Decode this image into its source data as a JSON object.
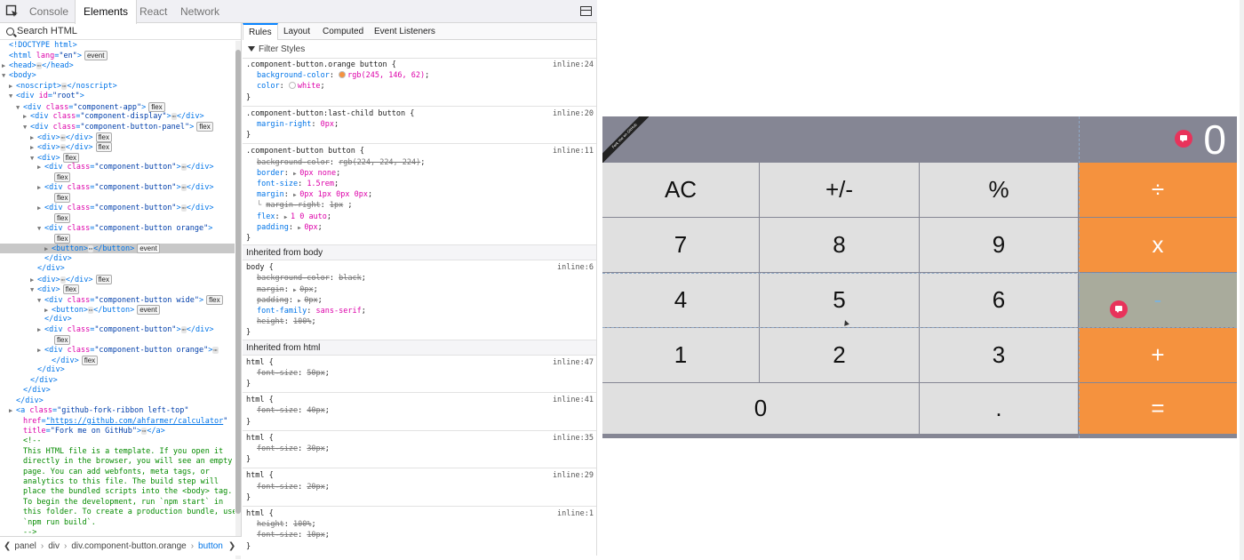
{
  "devtools": {
    "tabs": [
      "Console",
      "Elements",
      "React",
      "Network"
    ],
    "active_tab": "Elements",
    "search_placeholder": "Search HTML",
    "markup_lines": [
      {
        "html": "<span class='tg'>&lt;!DOCTYPE html&gt;</span>",
        "indent": 0,
        "tw": ""
      },
      {
        "html": "<span class='tg'>&lt;html </span><span class='at'>lang</span>=<span class='av'>\"en\"</span><span class='tg'>&gt;</span><span class='badge'>event</span>",
        "indent": 0,
        "tw": ""
      },
      {
        "html": "<span class='tg'>&lt;head&gt;</span><span class='dots'>⋯</span><span class='tg'>&lt;/head&gt;</span>",
        "indent": 0,
        "tw": "▶"
      },
      {
        "html": "<span class='tg'>&lt;body&gt;</span>",
        "indent": 0,
        "tw": "▼"
      },
      {
        "html": "<span class='tg'>&lt;noscript&gt;</span><span class='dots'>⋯</span><span class='tg'>&lt;/noscript&gt;</span>",
        "indent": 1,
        "tw": "▶"
      },
      {
        "html": "<span class='tg'>&lt;div </span><span class='at'>id</span>=<span class='av'>\"root\"</span><span class='tg'>&gt;</span>",
        "indent": 1,
        "tw": "▼"
      },
      {
        "html": "<span class='tg'>&lt;div </span><span class='at'>class</span>=<span class='av'>\"component-app\"</span><span class='tg'>&gt;</span><span class='badge'>flex</span>",
        "indent": 2,
        "tw": "▼"
      },
      {
        "html": "<span class='tg'>&lt;div </span><span class='at'>class</span>=<span class='av'>\"component-display\"</span><span class='tg'>&gt;</span><span class='dots'>⋯</span><span class='tg'>&lt;/div&gt;</span>",
        "indent": 3,
        "tw": "▶"
      },
      {
        "html": "<span class='tg'>&lt;div </span><span class='at'>class</span>=<span class='av'>\"component-button-panel\"</span><span class='tg'>&gt;</span><span class='badge'>flex</span>",
        "indent": 3,
        "tw": "▼"
      },
      {
        "html": "<span class='tg'>&lt;div&gt;</span><span class='dots'>⋯</span><span class='tg'>&lt;/div&gt;</span><span class='badge'>flex</span>",
        "indent": 4,
        "tw": "▶"
      },
      {
        "html": "<span class='tg'>&lt;div&gt;</span><span class='dots'>⋯</span><span class='tg'>&lt;/div&gt;</span><span class='badge'>flex</span>",
        "indent": 4,
        "tw": "▶"
      },
      {
        "html": "<span class='tg'>&lt;div&gt;</span><span class='badge'>flex</span>",
        "indent": 4,
        "tw": "▼"
      },
      {
        "html": "<span class='tg'>&lt;div </span><span class='at'>class</span>=<span class='av'>\"component-button\"</span><span class='tg'>&gt;</span><span class='dots'>⋯</span><span class='tg'>&lt;/div&gt;</span>",
        "indent": 5,
        "tw": "▶"
      },
      {
        "html": "<span class='badge'>flex</span>",
        "indent": 6,
        "tw": ""
      },
      {
        "html": "<span class='tg'>&lt;div </span><span class='at'>class</span>=<span class='av'>\"component-button\"</span><span class='tg'>&gt;</span><span class='dots'>⋯</span><span class='tg'>&lt;/div&gt;</span>",
        "indent": 5,
        "tw": "▶"
      },
      {
        "html": "<span class='badge'>flex</span>",
        "indent": 6,
        "tw": ""
      },
      {
        "html": "<span class='tg'>&lt;div </span><span class='at'>class</span>=<span class='av'>\"component-button\"</span><span class='tg'>&gt;</span><span class='dots'>⋯</span><span class='tg'>&lt;/div&gt;</span>",
        "indent": 5,
        "tw": "▶"
      },
      {
        "html": "<span class='badge'>flex</span>",
        "indent": 6,
        "tw": ""
      },
      {
        "html": "<span class='tg'>&lt;div </span><span class='at'>class</span>=<span class='av'>\"component-button orange\"</span><span class='tg'>&gt;</span>",
        "indent": 5,
        "tw": "▼"
      },
      {
        "html": "<span class='badge'>flex</span>",
        "indent": 6,
        "tw": ""
      },
      {
        "html": "<span class='tg'>&lt;button&gt;</span><span class='dots'>⋯</span><span class='tg'>&lt;/button&gt;</span><span class='badge'>event</span>",
        "indent": 6,
        "tw": "▶",
        "selected": true
      },
      {
        "html": "<span class='tg'>&lt;/div&gt;</span>",
        "indent": 5,
        "tw": ""
      },
      {
        "html": "<span class='tg'>&lt;/div&gt;</span>",
        "indent": 4,
        "tw": ""
      },
      {
        "html": "<span class='tg'>&lt;div&gt;</span><span class='dots'>⋯</span><span class='tg'>&lt;/div&gt;</span><span class='badge'>flex</span>",
        "indent": 4,
        "tw": "▶"
      },
      {
        "html": "<span class='tg'>&lt;div&gt;</span><span class='badge'>flex</span>",
        "indent": 4,
        "tw": "▼"
      },
      {
        "html": "<span class='tg'>&lt;div </span><span class='at'>class</span>=<span class='av'>\"component-button wide\"</span><span class='tg'>&gt;</span><span class='badge'>flex</span>",
        "indent": 5,
        "tw": "▼"
      },
      {
        "html": "<span class='tg'>&lt;button&gt;</span><span class='dots'>⋯</span><span class='tg'>&lt;/button&gt;</span><span class='badge'>event</span>",
        "indent": 6,
        "tw": "▶"
      },
      {
        "html": "<span class='tg'>&lt;/div&gt;</span>",
        "indent": 5,
        "tw": ""
      },
      {
        "html": "<span class='tg'>&lt;div </span><span class='at'>class</span>=<span class='av'>\"component-button\"</span><span class='tg'>&gt;</span><span class='dots'>⋯</span><span class='tg'>&lt;/div&gt;</span>",
        "indent": 5,
        "tw": "▶"
      },
      {
        "html": "<span class='badge'>flex</span>",
        "indent": 6,
        "tw": ""
      },
      {
        "html": "<span class='tg'>&lt;div </span><span class='at'>class</span>=<span class='av'>\"component-button orange\"</span><span class='tg'>&gt;</span><span class='dots'>⋯</span>",
        "indent": 5,
        "tw": "▶"
      },
      {
        "html": "<span class='tg'>&lt;/div&gt;</span><span class='badge'>flex</span>",
        "indent": 6,
        "tw": ""
      },
      {
        "html": "<span class='tg'>&lt;/div&gt;</span>",
        "indent": 4,
        "tw": ""
      },
      {
        "html": "<span class='tg'>&lt;/div&gt;</span>",
        "indent": 3,
        "tw": ""
      },
      {
        "html": "<span class='tg'>&lt;/div&gt;</span>",
        "indent": 2,
        "tw": ""
      },
      {
        "html": "<span class='tg'>&lt;/div&gt;</span>",
        "indent": 1,
        "tw": ""
      },
      {
        "html": "<span class='tg'>&lt;a </span><span class='at'>class</span>=<span class='av'>\"github-fork-ribbon left-top\"</span>",
        "indent": 1,
        "tw": "▶"
      },
      {
        "html": "<span class='at'>href</span>=<span class='av lnk'>\"https://github.com/ahfarmer/calculator</span><span class='av'>\"</span>",
        "indent": 2,
        "tw": ""
      },
      {
        "html": "<span class='at'>title</span>=<span class='av'>\"Fork me on GitHub\"</span><span class='tg'>&gt;</span><span class='dots'>⋯</span><span class='tg'>&lt;/a&gt;</span>",
        "indent": 2,
        "tw": ""
      },
      {
        "html": "&lt;!--",
        "indent": 2,
        "tw": "",
        "note": true
      },
      {
        "html": "This HTML file is a template. If you open it",
        "indent": 2,
        "tw": "",
        "note": true
      },
      {
        "html": "directly in the browser, you will see an empty",
        "indent": 2,
        "tw": "",
        "note": true
      },
      {
        "html": "page. You can add webfonts, meta tags, or",
        "indent": 2,
        "tw": "",
        "note": true
      },
      {
        "html": "analytics to this file. The build step will",
        "indent": 2,
        "tw": "",
        "note": true
      },
      {
        "html": "place the bundled scripts into the &lt;body&gt; tag.",
        "indent": 2,
        "tw": "",
        "note": true
      },
      {
        "html": "To begin the development, run `npm start` in",
        "indent": 2,
        "tw": "",
        "note": true
      },
      {
        "html": "this folder. To create a production bundle, use",
        "indent": 2,
        "tw": "",
        "note": true
      },
      {
        "html": "`npm run build`.",
        "indent": 2,
        "tw": "",
        "note": true
      },
      {
        "html": "--&gt;",
        "indent": 2,
        "tw": "",
        "note": true
      }
    ],
    "breadcrumbs": [
      "panel",
      "div",
      "div.component-button.orange",
      "button"
    ],
    "rules_tabs": [
      "Rules",
      "Layout",
      "Computed",
      "Event Listeners"
    ],
    "active_rules_tab": "Rules",
    "filter_placeholder": "Filter Styles",
    "rules": [
      {
        "type": "sel",
        "text": ".component-button.orange button {",
        "src": "inline:24"
      },
      {
        "type": "prop",
        "name": "background-color",
        "value": "rgb(245, 146, 62)",
        "swatch": "#f5923e"
      },
      {
        "type": "prop",
        "name": "color",
        "value": "white",
        "swatch": "#ffffff"
      },
      {
        "type": "close",
        "text": "}"
      },
      {
        "type": "sep"
      },
      {
        "type": "sel",
        "text": ".component-button:last-child button {",
        "src": "inline:20"
      },
      {
        "type": "prop",
        "name": "margin-right",
        "value": "0px"
      },
      {
        "type": "close",
        "text": "}"
      },
      {
        "type": "sep"
      },
      {
        "type": "sel",
        "text": ".component-button button {",
        "src": "inline:11"
      },
      {
        "type": "prop",
        "name": "background-color",
        "value": "rgb(224, 224, 224)",
        "struck": true
      },
      {
        "type": "prop",
        "name": "border",
        "value": "0px none",
        "tri": true
      },
      {
        "type": "prop",
        "name": "font-size",
        "value": "1.5rem"
      },
      {
        "type": "prop",
        "name": "margin",
        "value": "0px 1px 0px 0px",
        "tri": true
      },
      {
        "type": "sub",
        "name": "margin-right",
        "value": "1px",
        "struck": true
      },
      {
        "type": "prop",
        "name": "flex",
        "value": "1 0 auto",
        "tri": true
      },
      {
        "type": "prop",
        "name": "padding",
        "value": "0px",
        "tri": true
      },
      {
        "type": "close",
        "text": "}"
      },
      {
        "type": "inh",
        "text": "Inherited from body"
      },
      {
        "type": "sel",
        "text": "body {",
        "src": "inline:6"
      },
      {
        "type": "prop",
        "name": "background-color",
        "value": "black",
        "struck": true
      },
      {
        "type": "prop",
        "name": "margin",
        "value": "0px",
        "struck": true,
        "tri": true
      },
      {
        "type": "prop",
        "name": "padding",
        "value": "0px",
        "struck": true,
        "tri": true
      },
      {
        "type": "prop",
        "name": "font-family",
        "value": "sans-serif"
      },
      {
        "type": "prop",
        "name": "height",
        "value": "100%",
        "struck": true
      },
      {
        "type": "close",
        "text": "}"
      },
      {
        "type": "inh",
        "text": "Inherited from html"
      },
      {
        "type": "sel",
        "text": "html {",
        "src": "inline:47"
      },
      {
        "type": "prop",
        "name": "font-size",
        "value": "50px",
        "struck": true
      },
      {
        "type": "close",
        "text": "}"
      },
      {
        "type": "sep"
      },
      {
        "type": "sel",
        "text": "html {",
        "src": "inline:41"
      },
      {
        "type": "prop",
        "name": "font-size",
        "value": "40px",
        "struck": true
      },
      {
        "type": "close",
        "text": "}"
      },
      {
        "type": "sep"
      },
      {
        "type": "sel",
        "text": "html {",
        "src": "inline:35"
      },
      {
        "type": "prop",
        "name": "font-size",
        "value": "30px",
        "struck": true
      },
      {
        "type": "close",
        "text": "}"
      },
      {
        "type": "sep"
      },
      {
        "type": "sel",
        "text": "html {",
        "src": "inline:29"
      },
      {
        "type": "prop",
        "name": "font-size",
        "value": "20px",
        "struck": true
      },
      {
        "type": "close",
        "text": "}"
      },
      {
        "type": "sep"
      },
      {
        "type": "sel",
        "text": "html {",
        "src": "inline:1"
      },
      {
        "type": "prop",
        "name": "height",
        "value": "100%",
        "struck": true
      },
      {
        "type": "prop",
        "name": "font-size",
        "value": "10px",
        "struck": true
      },
      {
        "type": "close",
        "text": "}"
      }
    ]
  },
  "calculator": {
    "display": "0",
    "ribbon_text": "Fork me on GitHub",
    "colors": {
      "display_bg": "#858694",
      "button_bg": "#e0e0e0",
      "orange": "#f5923e",
      "highlight": "#a9ab9c"
    },
    "rows": [
      [
        {
          "label": "AC"
        },
        {
          "label": "+/-"
        },
        {
          "label": "%"
        },
        {
          "label": "÷",
          "orange": true
        }
      ],
      [
        {
          "label": "7"
        },
        {
          "label": "8"
        },
        {
          "label": "9"
        },
        {
          "label": "x",
          "orange": true
        }
      ],
      [
        {
          "label": "4"
        },
        {
          "label": "5"
        },
        {
          "label": "6"
        },
        {
          "label": "-",
          "orange": true,
          "highlight": true
        }
      ],
      [
        {
          "label": "1"
        },
        {
          "label": "2"
        },
        {
          "label": "3"
        },
        {
          "label": "+",
          "orange": true
        }
      ],
      [
        {
          "label": "0",
          "wide": true
        },
        {
          "label": "."
        },
        {
          "label": "=",
          "orange": true
        }
      ]
    ]
  }
}
